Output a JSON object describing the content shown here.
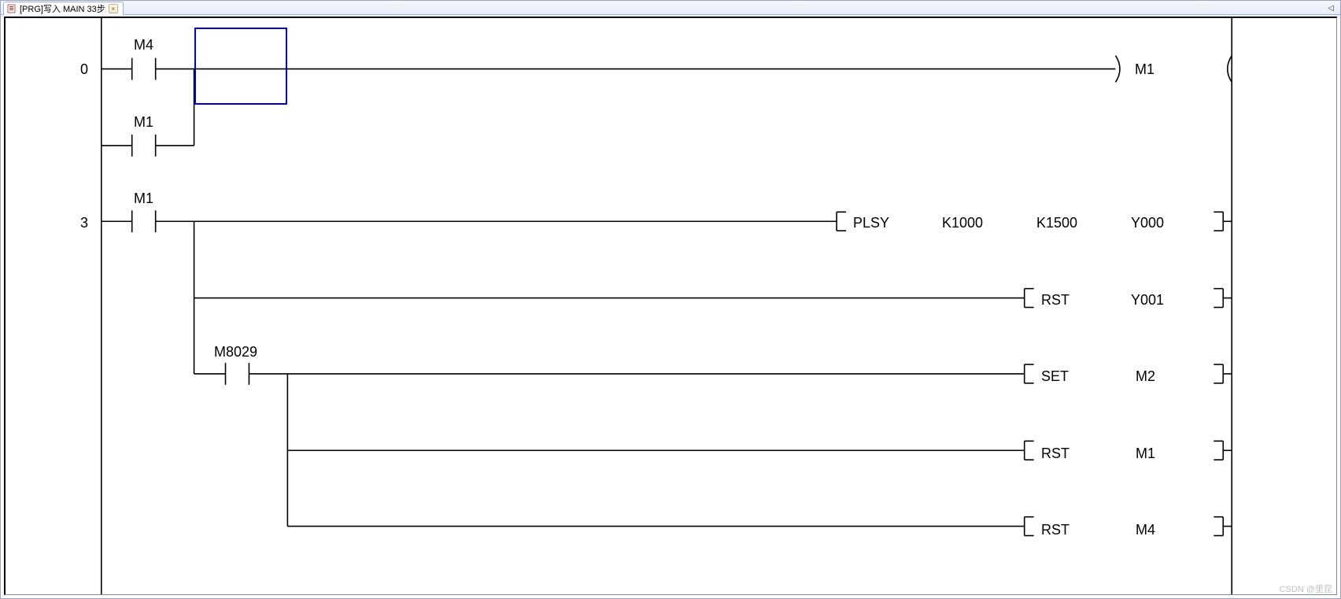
{
  "tab": {
    "title": "[PRG]写入 MAIN 33步",
    "close_symbol": "×"
  },
  "nav": {
    "left_arrow": "◁"
  },
  "ladder": {
    "step_labels": {
      "rung0": "0",
      "rung1": "3"
    },
    "contacts": {
      "m4": "M4",
      "m1_parallel": "M1",
      "m1_main": "M1",
      "m8029": "M8029"
    },
    "outputs": {
      "coil_m1": "M1",
      "plsy_instr": "PLSY",
      "plsy_k1000": "K1000",
      "plsy_k1500": "K1500",
      "plsy_y000": "Y000",
      "rst1_instr": "RST",
      "rst1_y001": "Y001",
      "set_instr": "SET",
      "set_m2": "M2",
      "rst2_instr": "RST",
      "rst2_m1": "M1",
      "rst3_instr": "RST",
      "rst3_m4": "M4"
    }
  },
  "watermark": "CSDN @里昆"
}
